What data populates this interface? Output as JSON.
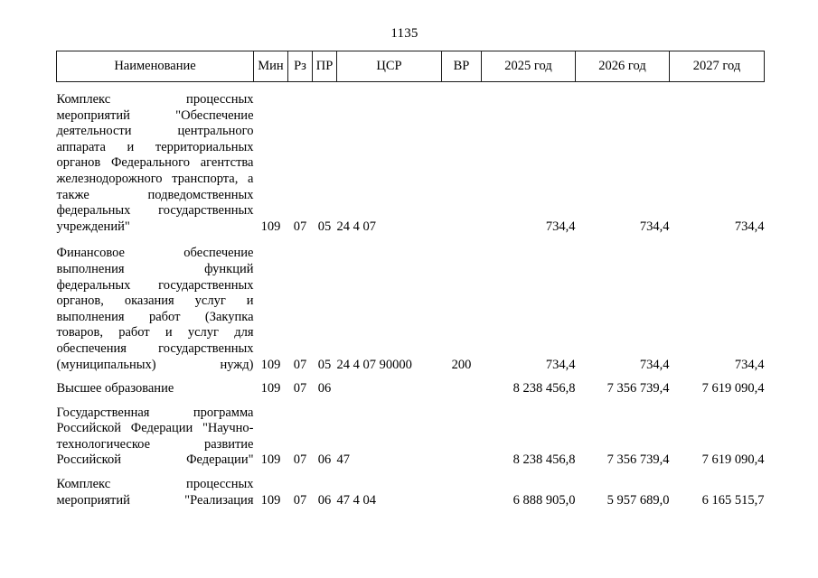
{
  "document": {
    "page_number": "1135",
    "language": "ru"
  },
  "table": {
    "headers": [
      {
        "key": "name",
        "label": "Наименование"
      },
      {
        "key": "min",
        "label": "Мин"
      },
      {
        "key": "rz",
        "label": "Рз"
      },
      {
        "key": "pr",
        "label": "ПР"
      },
      {
        "key": "csr",
        "label": "ЦСР"
      },
      {
        "key": "vr",
        "label": "ВР"
      },
      {
        "key": "y2025",
        "label": "2025 год"
      },
      {
        "key": "y2026",
        "label": "2026 год"
      },
      {
        "key": "y2027",
        "label": "2027 год"
      }
    ],
    "rows": [
      {
        "name": "Комплекс процессных мероприятий \"Обеспечение деятельности центрального аппарата и территориальных органов Федерального агентства железнодорожного транспорта, а также подведомственных федеральных государственных учреждений\"",
        "min": "109",
        "rz": "07",
        "pr": "05",
        "csr": "24 4 07",
        "vr": "",
        "y2025": "734,4",
        "y2026": "734,4",
        "y2027": "734,4"
      },
      {
        "name": "Финансовое обеспечение выполнения функций федеральных государственных органов, оказания услуг и выполнения работ (Закупка товаров, работ и услуг для обеспечения государственных (муниципальных) нужд)",
        "min": "109",
        "rz": "07",
        "pr": "05",
        "csr": "24 4 07 90000",
        "vr": "200",
        "y2025": "734,4",
        "y2026": "734,4",
        "y2027": "734,4"
      },
      {
        "name": "Высшее образование",
        "min": "109",
        "rz": "07",
        "pr": "06",
        "csr": "",
        "vr": "",
        "y2025": "8 238 456,8",
        "y2026": "7 356 739,4",
        "y2027": "7 619 090,4"
      },
      {
        "name": "Государственная программа Российской Федерации \"Научно-технологическое развитие Российской Федерации\"",
        "min": "109",
        "rz": "07",
        "pr": "06",
        "csr": "47",
        "vr": "",
        "y2025": "8 238 456,8",
        "y2026": "7 356 739,4",
        "y2027": "7 619 090,4"
      },
      {
        "name": "Комплекс процессных мероприятий \"Реализация",
        "min": "109",
        "rz": "07",
        "pr": "06",
        "csr": "47 4 04",
        "vr": "",
        "y2025": "6 888 905,0",
        "y2026": "5 957 689,0",
        "y2027": "6 165 515,7"
      }
    ]
  }
}
